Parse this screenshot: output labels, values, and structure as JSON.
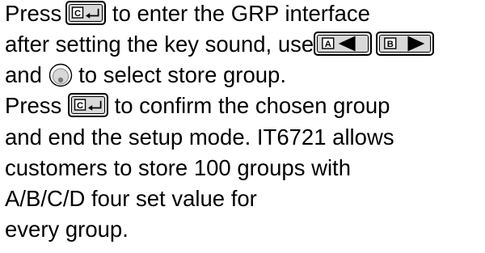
{
  "document": {
    "line1": {
      "before": "Press",
      "after": " to enter the GRP interface"
    },
    "line2": {
      "before": "after setting the key sound, use"
    },
    "line3": {
      "before": "and ",
      "after": " to select store group."
    },
    "line4": {
      "before": "Press ",
      "after": " to confirm the chosen group"
    },
    "line5": "and end the setup mode. IT6721 allows",
    "line6": "customers to store 100 groups with",
    "line7": "A/B/C/D four set value for",
    "line8": "every group.",
    "keys": {
      "enter_key_letter": "C",
      "left_key_letter": "A",
      "right_key_letter": "B"
    },
    "icons": {
      "enter_key": "enter-arrow-icon",
      "left_key": "left-triangle-icon",
      "right_key": "right-triangle-icon",
      "knob": "rotary-knob-icon"
    }
  }
}
